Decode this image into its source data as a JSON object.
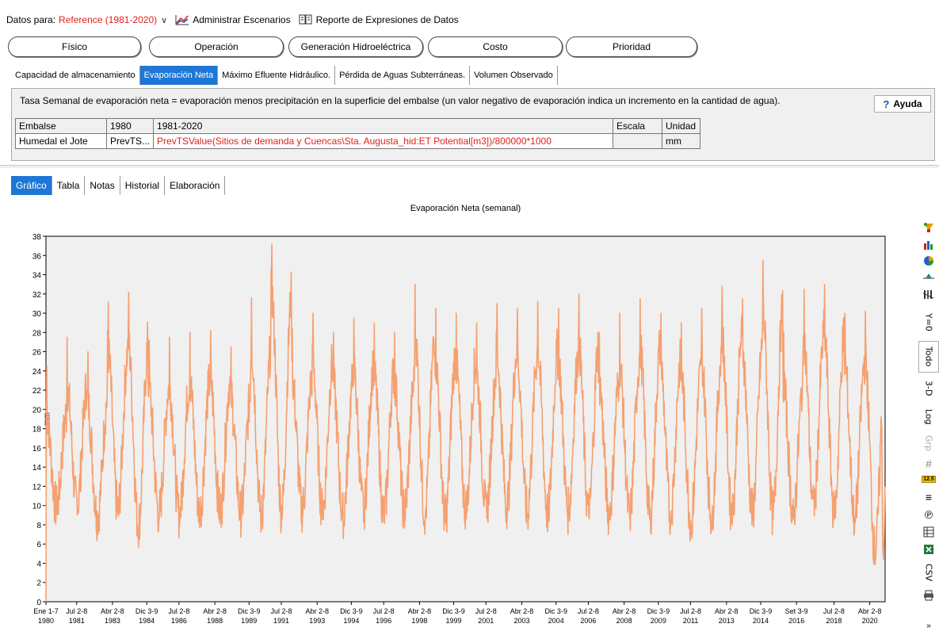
{
  "toolbar": {
    "data_for_label": "Datos para:",
    "scenario_value": "Reference (1981-2020)",
    "manage_scenarios_label": "Administrar Escenarios",
    "data_expressions_report_label": "Reporte de Expresiones de Datos"
  },
  "category_tabs": [
    {
      "label": "Físico",
      "active": true
    },
    {
      "label": "Operación",
      "active": false
    },
    {
      "label": "Generación Hidroeléctrica",
      "active": false
    },
    {
      "label": "Costo",
      "active": false
    },
    {
      "label": "Prioridad",
      "active": false
    }
  ],
  "variable_tabs": [
    {
      "label": "Capacidad de almacenamiento",
      "active": false
    },
    {
      "label": "Evaporación Neta",
      "active": true
    },
    {
      "label": "Máximo Efluente Hidráulico.",
      "active": false
    },
    {
      "label": "Pérdida de Aguas Subterráneas.",
      "active": false
    },
    {
      "label": "Volumen Observado",
      "active": false
    }
  ],
  "description": "Tasa Semanal de evaporación neta = evaporación menos precipitación en la superficie del embalse (un valor negativo de evaporación indica un incremento en la cantidad de agua).",
  "help_label": "Ayuda",
  "data_grid": {
    "headers": [
      "Embalse",
      "1980",
      "1981-2020",
      "Escala",
      "Unidad"
    ],
    "row": {
      "name": "Humedal el Jote",
      "y1980": "PrevTS...",
      "expression": "PrevTSValue(Sitios de demanda y Cuencas\\Sta. Augusta_hid:ET Potential[m3])/800000*1000",
      "scale": "",
      "unit": "mm"
    }
  },
  "view_tabs": [
    {
      "label": "Gráfico",
      "active": true
    },
    {
      "label": "Tabla",
      "active": false
    },
    {
      "label": "Notas",
      "active": false
    },
    {
      "label": "Historial",
      "active": false
    },
    {
      "label": "Elaboración",
      "active": false
    }
  ],
  "right_toolbar": {
    "y0": "Y=0",
    "all": "Todo",
    "three_d": "3-D",
    "log": "Log",
    "grp": "Grp",
    "decimals": "12.5",
    "csv": "CSV"
  },
  "chart_data": {
    "type": "line",
    "title": "Evaporación Neta (semanal)",
    "xlabel": "",
    "ylabel": "mm",
    "ylim": [
      0,
      38
    ],
    "yticks": [
      0,
      2,
      4,
      6,
      8,
      10,
      12,
      14,
      16,
      18,
      20,
      22,
      24,
      26,
      28,
      30,
      32,
      34,
      36,
      38
    ],
    "xlim": [
      "1980-01-01",
      "2021-01-01"
    ],
    "grid": false,
    "color": "#f5a070",
    "x_tick_labels": [
      {
        "top": "Ene 1-7",
        "bottom": "1980",
        "date": "1980-01-01"
      },
      {
        "top": "Jul 2-8",
        "bottom": "1981",
        "date": "1981-07-02"
      },
      {
        "top": "Abr 2-8",
        "bottom": "1983",
        "date": "1983-04-02"
      },
      {
        "top": "Dic 3-9",
        "bottom": "1984",
        "date": "1984-12-03"
      },
      {
        "top": "Jul 2-8",
        "bottom": "1986",
        "date": "1986-07-02"
      },
      {
        "top": "Abr 2-8",
        "bottom": "1988",
        "date": "1988-04-02"
      },
      {
        "top": "Dic 3-9",
        "bottom": "1989",
        "date": "1989-12-03"
      },
      {
        "top": "Jul 2-8",
        "bottom": "1991",
        "date": "1991-07-02"
      },
      {
        "top": "Abr 2-8",
        "bottom": "1993",
        "date": "1993-04-02"
      },
      {
        "top": "Dic 3-9",
        "bottom": "1994",
        "date": "1994-12-03"
      },
      {
        "top": "Jul 2-8",
        "bottom": "1996",
        "date": "1996-07-02"
      },
      {
        "top": "Abr 2-8",
        "bottom": "1998",
        "date": "1998-04-02"
      },
      {
        "top": "Dic 3-9",
        "bottom": "1999",
        "date": "1999-12-03"
      },
      {
        "top": "Jul 2-8",
        "bottom": "2001",
        "date": "2001-07-02"
      },
      {
        "top": "Abr 2-8",
        "bottom": "2003",
        "date": "2003-04-02"
      },
      {
        "top": "Dic 3-9",
        "bottom": "2004",
        "date": "2004-12-03"
      },
      {
        "top": "Jul 2-8",
        "bottom": "2006",
        "date": "2006-07-02"
      },
      {
        "top": "Abr 2-8",
        "bottom": "2008",
        "date": "2008-04-02"
      },
      {
        "top": "Dic 3-9",
        "bottom": "2009",
        "date": "2009-12-03"
      },
      {
        "top": "Jul 2-8",
        "bottom": "2011",
        "date": "2011-07-02"
      },
      {
        "top": "Abr 2-8",
        "bottom": "2013",
        "date": "2013-04-02"
      },
      {
        "top": "Dic 3-9",
        "bottom": "2014",
        "date": "2014-12-03"
      },
      {
        "top": "Set 3-9",
        "bottom": "2016",
        "date": "2016-09-03"
      },
      {
        "top": "Jul 2-8",
        "bottom": "2018",
        "date": "2018-07-02"
      },
      {
        "top": "Abr 2-8",
        "bottom": "2020",
        "date": "2020-04-02"
      }
    ],
    "annual_extremes": [
      {
        "year": 1980,
        "peak": 24.5,
        "trough": 8.8
      },
      {
        "year": 1981,
        "peak": 27.5,
        "trough": 9.0
      },
      {
        "year": 1982,
        "peak": 26.0,
        "trough": 7.8
      },
      {
        "year": 1983,
        "peak": 31.2,
        "trough": 8.6
      },
      {
        "year": 1984,
        "peak": 32.2,
        "trough": 7.0
      },
      {
        "year": 1985,
        "peak": 27.2,
        "trough": 8.2
      },
      {
        "year": 1986,
        "peak": 27.5,
        "trough": 8.0
      },
      {
        "year": 1987,
        "peak": 28.0,
        "trough": 8.2
      },
      {
        "year": 1988,
        "peak": 28.2,
        "trough": 8.4
      },
      {
        "year": 1989,
        "peak": 26.5,
        "trough": 8.2
      },
      {
        "year": 1990,
        "peak": 31.6,
        "trough": 8.0
      },
      {
        "year": 1991,
        "peak": 37.2,
        "trough": 8.4
      },
      {
        "year": 1992,
        "peak": 28.4,
        "trough": 8.6
      },
      {
        "year": 1993,
        "peak": 30.0,
        "trough": 8.4
      },
      {
        "year": 1994,
        "peak": 28.0,
        "trough": 8.0
      },
      {
        "year": 1995,
        "peak": 29.5,
        "trough": 8.6
      },
      {
        "year": 1996,
        "peak": 29.0,
        "trough": 8.0
      },
      {
        "year": 1997,
        "peak": 28.0,
        "trough": 8.4
      },
      {
        "year": 1998,
        "peak": 33.0,
        "trough": 8.2
      },
      {
        "year": 1999,
        "peak": 30.5,
        "trough": 7.8
      },
      {
        "year": 2000,
        "peak": 30.0,
        "trough": 8.6
      },
      {
        "year": 2001,
        "peak": 29.0,
        "trough": 8.4
      },
      {
        "year": 2002,
        "peak": 31.0,
        "trough": 9.0
      },
      {
        "year": 2003,
        "peak": 30.5,
        "trough": 8.4
      },
      {
        "year": 2004,
        "peak": 31.2,
        "trough": 8.2
      },
      {
        "year": 2005,
        "peak": 30.5,
        "trough": 8.4
      },
      {
        "year": 2006,
        "peak": 32.0,
        "trough": 8.2
      },
      {
        "year": 2007,
        "peak": 28.0,
        "trough": 8.2
      },
      {
        "year": 2008,
        "peak": 30.0,
        "trough": 8.0
      },
      {
        "year": 2009,
        "peak": 31.5,
        "trough": 8.0
      },
      {
        "year": 2010,
        "peak": 30.0,
        "trough": 8.2
      },
      {
        "year": 2011,
        "peak": 29.0,
        "trough": 7.4
      },
      {
        "year": 2012,
        "peak": 30.5,
        "trough": 8.0
      },
      {
        "year": 2013,
        "peak": 32.8,
        "trough": 8.0
      },
      {
        "year": 2014,
        "peak": 31.5,
        "trough": 8.4
      },
      {
        "year": 2015,
        "peak": 35.5,
        "trough": 8.2
      },
      {
        "year": 2016,
        "peak": 28.0,
        "trough": 8.2
      },
      {
        "year": 2017,
        "peak": 32.5,
        "trough": 8.8
      },
      {
        "year": 2018,
        "peak": 33.0,
        "trough": 8.2
      },
      {
        "year": 2019,
        "peak": 30.0,
        "trough": 7.8
      },
      {
        "year": 2020,
        "peak": 30.2,
        "trough": 4.3
      }
    ],
    "end_value": 12.0
  }
}
